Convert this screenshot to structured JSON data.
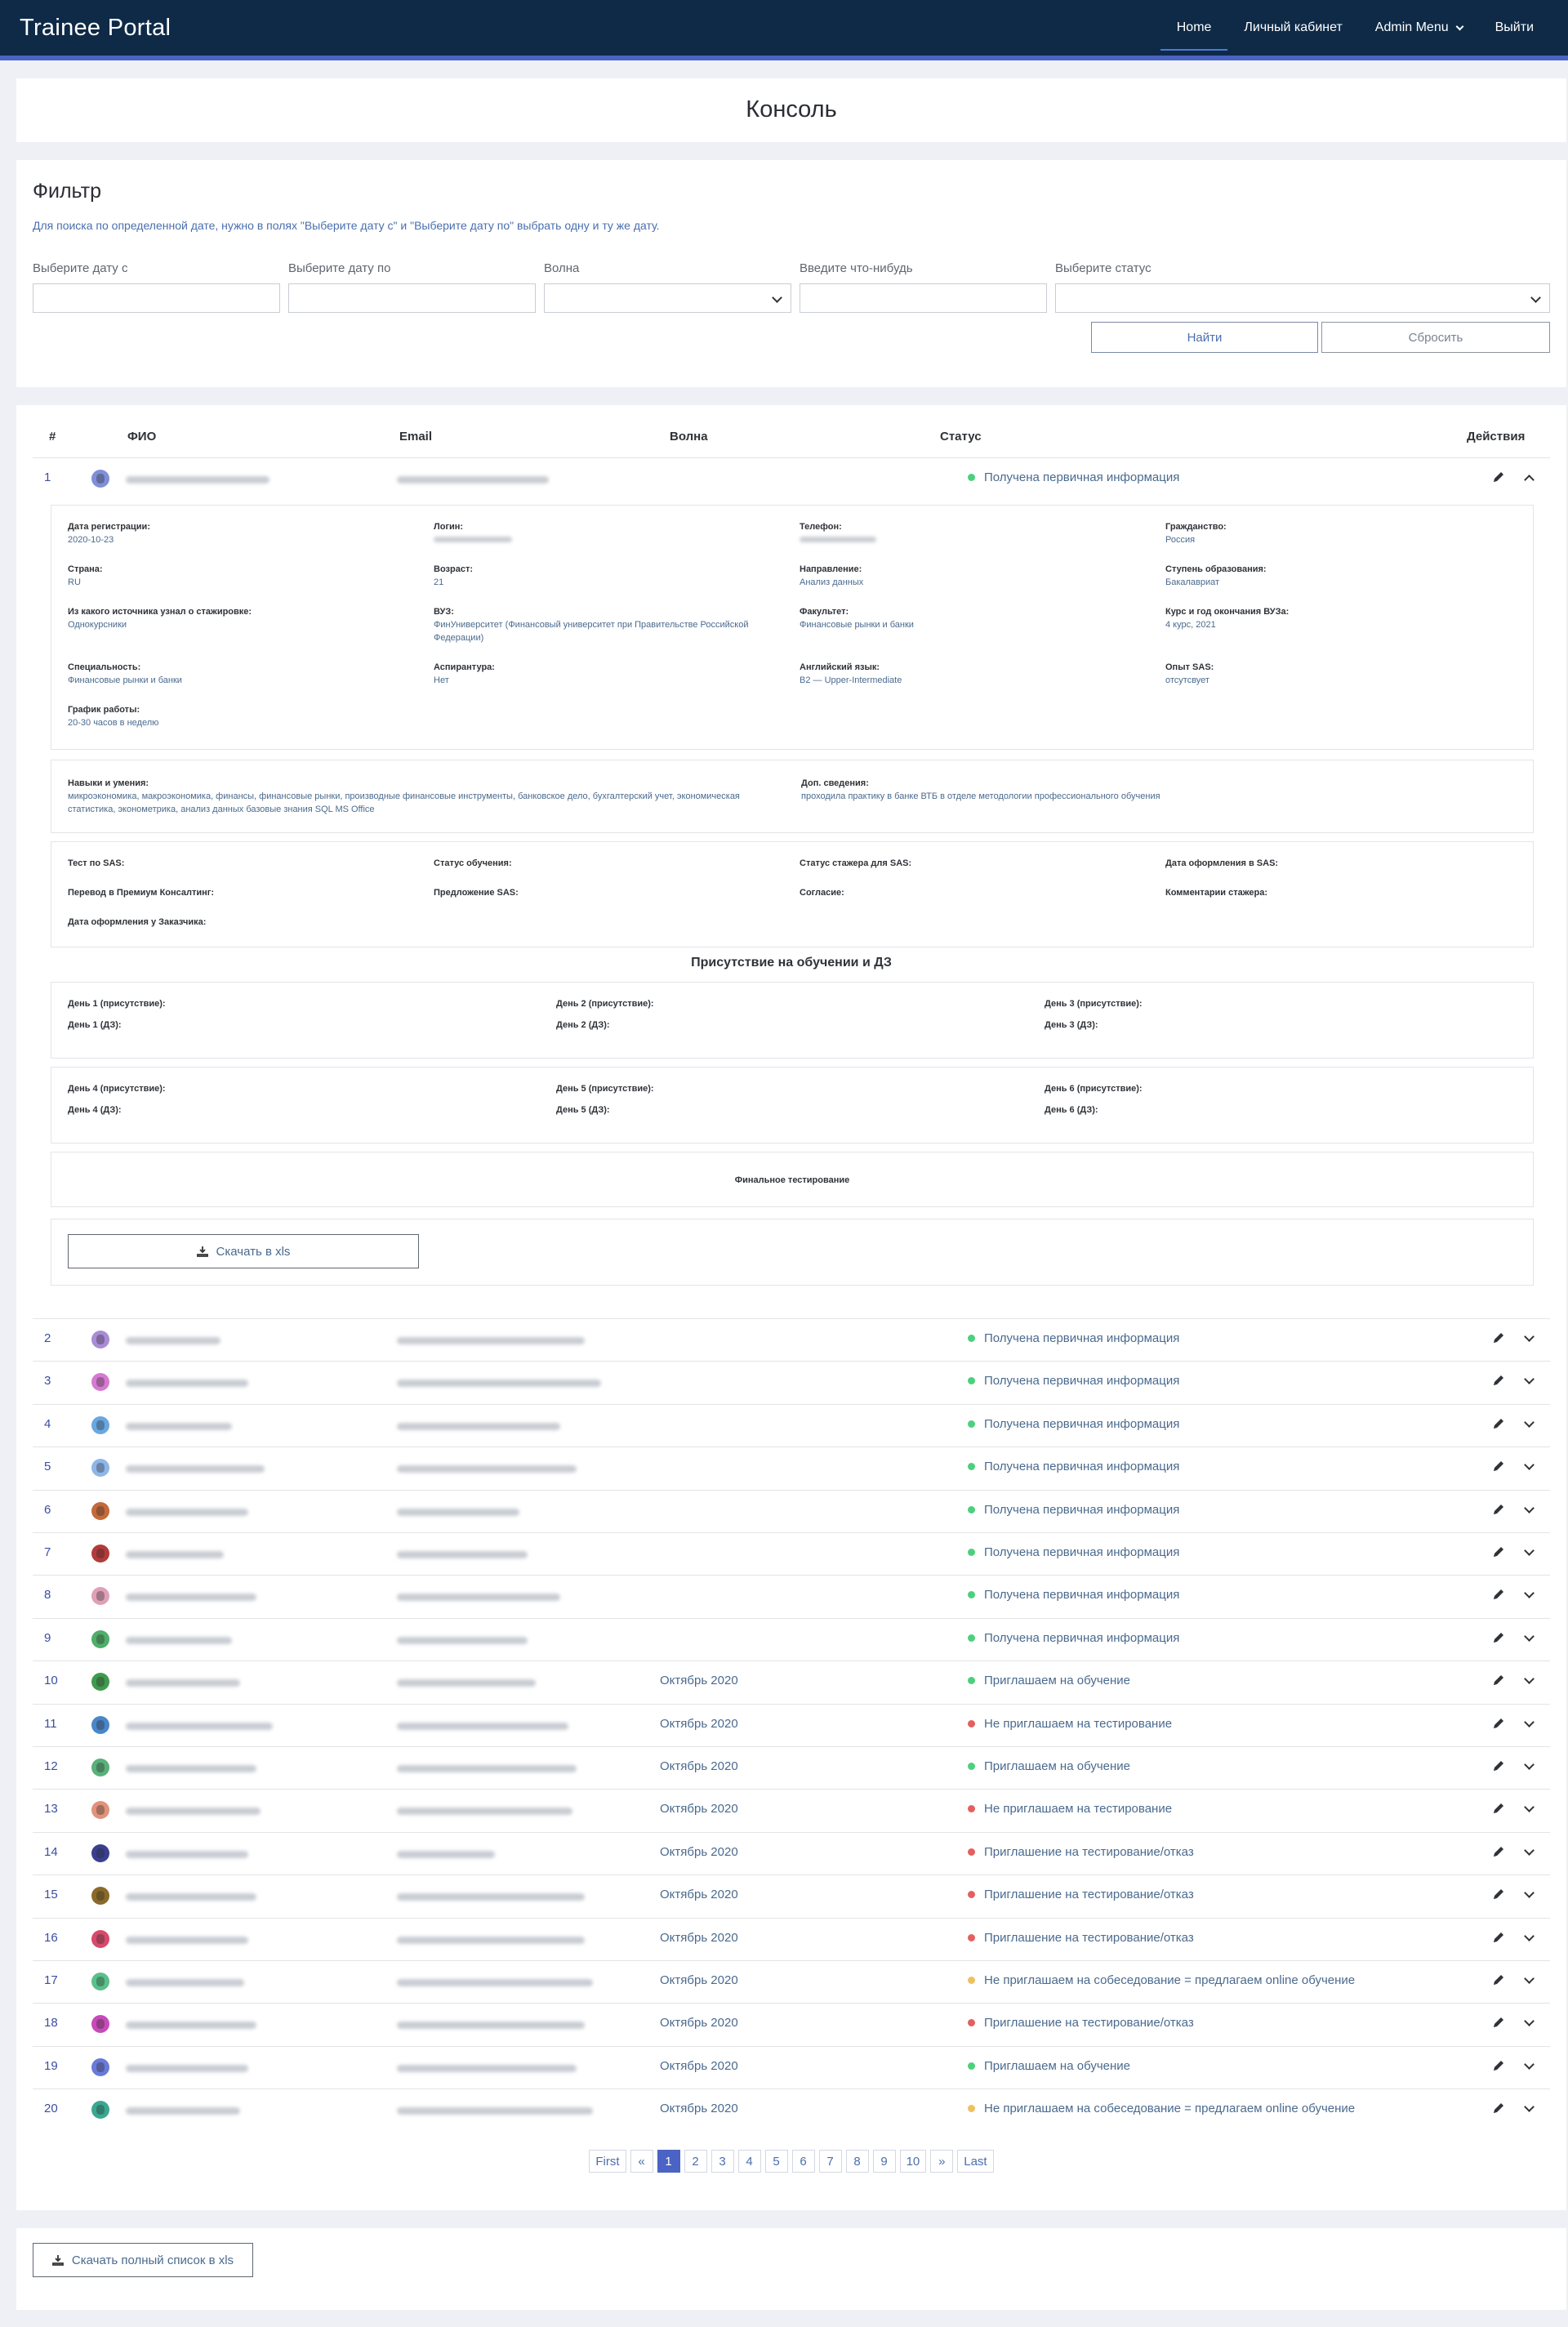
{
  "nav": {
    "brand": "Trainee Portal",
    "items": [
      "Home",
      "Личный кабинет",
      "Admin Menu",
      "Выйти"
    ]
  },
  "page": {
    "title": "Консоль"
  },
  "filter": {
    "title": "Фильтр",
    "hint": "Для поиска по определенной дате, нужно в полях \"Выберите дату с\" и \"Выберите дату по\" выбрать одну и ту же дату.",
    "labels": [
      "Выберите дату с",
      "Выберите дату по",
      "Волна",
      "Введите что-нибудь",
      "Выберите статус"
    ],
    "find_label": "Найти",
    "reset_label": "Сбросить"
  },
  "table": {
    "headers": [
      "#",
      "ФИО",
      "Email",
      "Волна",
      "Статус",
      "Действия"
    ],
    "rows": [
      {
        "num": "1",
        "wave": "",
        "status": "Получена первичная информация",
        "color": "#4cd07d",
        "avatar": "#7f8fd8"
      },
      {
        "num": "2",
        "wave": "",
        "status": "Получена первичная информация",
        "color": "#4cd07d",
        "avatar": "#a98bd6"
      },
      {
        "num": "3",
        "wave": "",
        "status": "Получена первичная информация",
        "color": "#4cd07d",
        "avatar": "#d67ad0"
      },
      {
        "num": "4",
        "wave": "",
        "status": "Получена первичная информация",
        "color": "#4cd07d",
        "avatar": "#6aa7e0"
      },
      {
        "num": "5",
        "wave": "",
        "status": "Получена первичная информация",
        "color": "#4cd07d",
        "avatar": "#8fb6e8"
      },
      {
        "num": "6",
        "wave": "",
        "status": "Получена первичная информация",
        "color": "#4cd07d",
        "avatar": "#c46a3b"
      },
      {
        "num": "7",
        "wave": "",
        "status": "Получена первичная информация",
        "color": "#4cd07d",
        "avatar": "#b43a3a"
      },
      {
        "num": "8",
        "wave": "",
        "status": "Получена первичная информация",
        "color": "#4cd07d",
        "avatar": "#e0a0b8"
      },
      {
        "num": "9",
        "wave": "",
        "status": "Получена первичная информация",
        "color": "#4cd07d",
        "avatar": "#4fae6a"
      },
      {
        "num": "10",
        "wave": "Октябрь 2020",
        "status": "Приглашаем на обучение",
        "color": "#4cd07d",
        "avatar": "#3f9a4e"
      },
      {
        "num": "11",
        "wave": "Октябрь 2020",
        "status": "Не приглашаем на тестирование",
        "color": "#e36060",
        "avatar": "#4a86c8"
      },
      {
        "num": "12",
        "wave": "Октябрь 2020",
        "status": "Приглашаем на обучение",
        "color": "#4cd07d",
        "avatar": "#5ab07a"
      },
      {
        "num": "13",
        "wave": "Октябрь 2020",
        "status": "Не приглашаем на тестирование",
        "color": "#e36060",
        "avatar": "#e0937a"
      },
      {
        "num": "14",
        "wave": "Октябрь 2020",
        "status": "Приглашение на тестирование/отказ",
        "color": "#e36060",
        "avatar": "#3a3f8e"
      },
      {
        "num": "15",
        "wave": "Октябрь 2020",
        "status": "Приглашение на тестирование/отказ",
        "color": "#e36060",
        "avatar": "#8a6a2a"
      },
      {
        "num": "16",
        "wave": "Октябрь 2020",
        "status": "Приглашение на тестирование/отказ",
        "color": "#e36060",
        "avatar": "#d84a6a"
      },
      {
        "num": "17",
        "wave": "Октябрь 2020",
        "status": "Не приглашаем на собеседование = предлагаем online обучение",
        "color": "#f0c060",
        "avatar": "#5ac08a"
      },
      {
        "num": "18",
        "wave": "Октябрь 2020",
        "status": "Приглашение на тестирование/отказ",
        "color": "#e36060",
        "avatar": "#c84ab8"
      },
      {
        "num": "19",
        "wave": "Октябрь 2020",
        "status": "Приглашаем на обучение",
        "color": "#4cd07d",
        "avatar": "#6a7ad8"
      },
      {
        "num": "20",
        "wave": "Октябрь 2020",
        "status": "Не приглашаем на собеседование = предлагаем online обучение",
        "color": "#f0c060",
        "avatar": "#3aa890"
      }
    ]
  },
  "details": {
    "fields": [
      {
        "label": "Дата регистрации:",
        "value": "2020-10-23"
      },
      {
        "label": "Логин:",
        "value": ""
      },
      {
        "label": "Телефон:",
        "value": ""
      },
      {
        "label": "Гражданство:",
        "value": "Россия"
      },
      {
        "label": "Страна:",
        "value": "RU"
      },
      {
        "label": "Возраст:",
        "value": "21"
      },
      {
        "label": "Направление:",
        "value": "Анализ данных"
      },
      {
        "label": "Ступень образования:",
        "value": "Бакалавриат"
      },
      {
        "label": "Из какого источника узнал о стажировке:",
        "value": "Однокурсники"
      },
      {
        "label": "ВУЗ:",
        "value": "ФинУниверситет (Финансовый университет при Правительстве Российской Федерации)"
      },
      {
        "label": "Факультет:",
        "value": "Финансовые рынки и банки"
      },
      {
        "label": "Курс и год окончания ВУЗа:",
        "value": "4 курс, 2021"
      },
      {
        "label": "Специальность:",
        "value": "Финансовые рынки и банки"
      },
      {
        "label": "Аспирантура:",
        "value": "Нет"
      },
      {
        "label": "Английский язык:",
        "value": "B2 — Upper-Intermediate"
      },
      {
        "label": "Опыт SAS:",
        "value": "отсутсвует"
      },
      {
        "label": "График работы:",
        "value": "20-30 часов в неделю"
      }
    ],
    "skills_label": "Навыки и умения:",
    "skills_value": "микроэкономика, макроэкономика, финансы, финансовые рынки, производные финансовые инструменты, банковское дело, бухгалтерский учет, экономическая статистика, эконометрика, анализ данных базовые знания SQL MS Office",
    "extra_label": "Доп. сведения:",
    "extra_value": "проходила практику в банке ВТБ в отделе методологии профессионального обучения",
    "sas_labels": [
      "Тест по SAS:",
      "Статус обучения:",
      "Статус стажера для SAS:",
      "Дата оформления в SAS:",
      "Перевод в Премиум Консалтинг:",
      "Предложение SAS:",
      "Согласие:",
      "Комментарии стажера:",
      "Дата оформления у Заказчика:"
    ],
    "attendance_title": "Присутствие на обучении и ДЗ",
    "days": [
      "День 1 (присутствие):",
      "День 1 (ДЗ):",
      "День 2 (присутствие):",
      "День 2 (ДЗ):",
      "День 3 (присутствие):",
      "День 3 (ДЗ):",
      "День 4 (присутствие):",
      "День 4 (ДЗ):",
      "День 5 (присутствие):",
      "День 5 (ДЗ):",
      "День 6 (присутствие):",
      "День 6 (ДЗ):"
    ],
    "final_test": "Финальное тестирование",
    "download_label": "Скачать в xls"
  },
  "pagination": {
    "items": [
      "First",
      "«",
      "1",
      "2",
      "3",
      "4",
      "5",
      "6",
      "7",
      "8",
      "9",
      "10",
      "»",
      "Last"
    ],
    "active": "1"
  },
  "footer": {
    "download_all_label": "Скачать полный список в xls"
  }
}
